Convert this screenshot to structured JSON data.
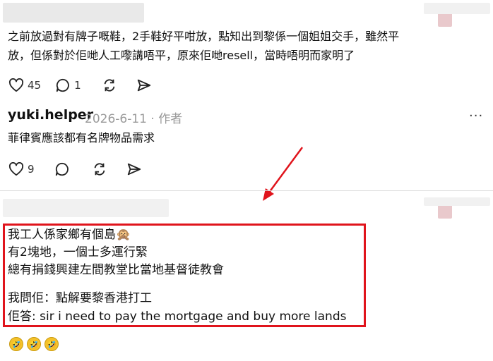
{
  "comments": [
    {
      "text_line1": "之前放過對有牌子嘅鞋，2手鞋好平咁放，點知出到黎係一個姐姐交手，雖然平",
      "text_line2": "放，但係對於佢哋人工嚟講唔平，原來佢哋resell，當時唔明而家明了",
      "likes": "45",
      "replies": "1"
    },
    {
      "username": "yuki.helper",
      "date": "2026-6-11",
      "separator": "·",
      "author_tag": "作者",
      "more": "···",
      "text": "菲律賓應該都有名牌物品需求",
      "likes": "9"
    },
    {
      "lines": [
        "我工人係家鄉有個島🙊",
        "有2塊地，一個士多運行緊",
        "總有捐錢興建左間教堂比當地基督徒教會",
        "我問佢：點解要黎香港打工",
        "佢答: sir i need to pay the mortgage and buy more lands"
      ],
      "reactions": [
        "🤣",
        "🤣",
        "🤣"
      ]
    }
  ],
  "colors": {
    "highlight_border": "#e0141c",
    "arrow": "#e0141c",
    "meta_text": "#9a9a9a"
  },
  "icons": [
    "heart-icon",
    "comment-icon",
    "repost-icon",
    "share-icon",
    "red-arrow-annotation"
  ]
}
